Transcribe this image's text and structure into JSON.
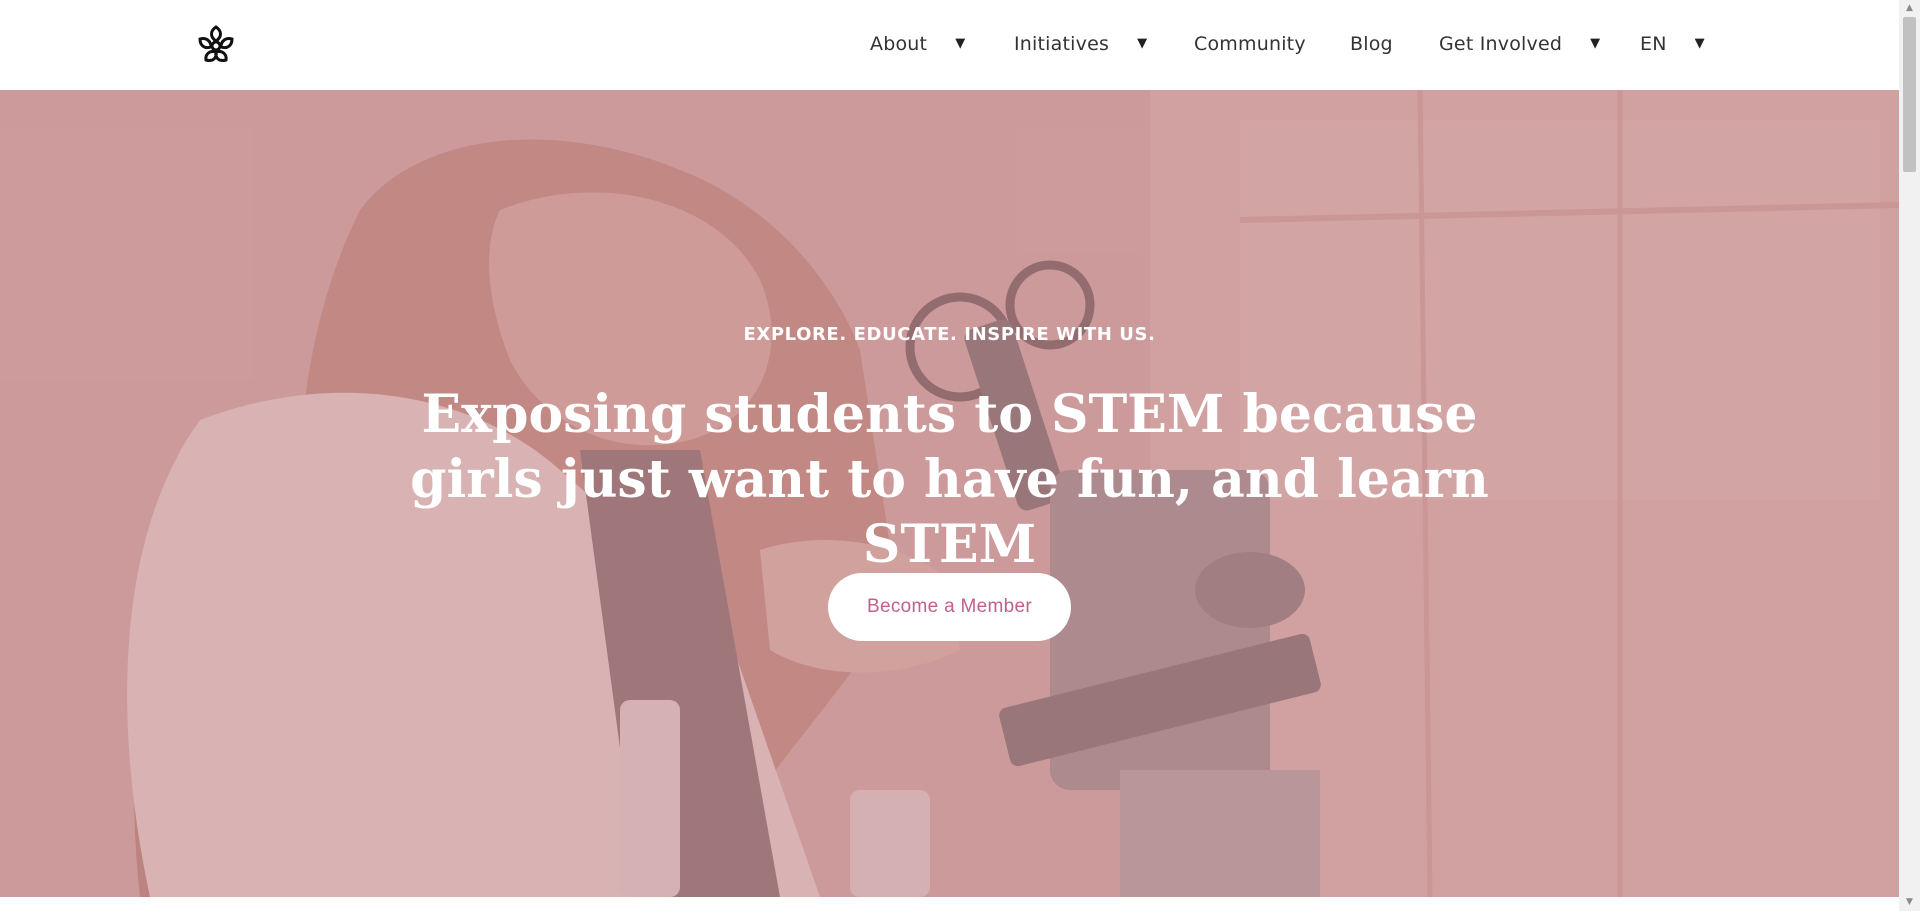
{
  "header": {
    "logo": "flower-logo-icon",
    "nav": [
      {
        "label": "About",
        "has_dropdown": true
      },
      {
        "label": "Initiatives",
        "has_dropdown": true
      },
      {
        "label": "Community",
        "has_dropdown": false
      },
      {
        "label": "Blog",
        "has_dropdown": false
      },
      {
        "label": "Get Involved",
        "has_dropdown": true
      },
      {
        "label": "EN",
        "has_dropdown": true
      }
    ],
    "caret_glyph": "▼"
  },
  "hero": {
    "tagline": "EXPLORE. EDUCATE. INSPIRE WITH US.",
    "headline": "Exposing students to STEM because girls just want to have fun, and learn STEM",
    "cta_label": "Become a Member",
    "overlay_color": "#cb9496",
    "cta_text_color": "#c0608e"
  }
}
